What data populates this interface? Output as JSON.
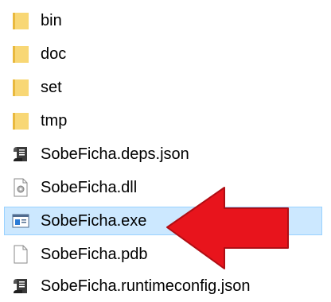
{
  "files": [
    {
      "name": "bin",
      "icon": "folder-icon"
    },
    {
      "name": "doc",
      "icon": "folder-icon"
    },
    {
      "name": "set",
      "icon": "folder-icon"
    },
    {
      "name": "tmp",
      "icon": "folder-icon"
    },
    {
      "name": "SobeFicha.deps.json",
      "icon": "json-file-icon"
    },
    {
      "name": "SobeFicha.dll",
      "icon": "dll-file-icon"
    },
    {
      "name": "SobeFicha.exe",
      "icon": "exe-file-icon",
      "selected": true
    },
    {
      "name": "SobeFicha.pdb",
      "icon": "blank-file-icon"
    },
    {
      "name": "SobeFicha.runtimeconfig.json",
      "icon": "json-file-icon"
    }
  ],
  "colors": {
    "folder": "#f8d775",
    "selection_bg": "#cce8ff",
    "selection_border": "#99d1ff",
    "arrow": "#e8141c"
  },
  "annotation": {
    "icon": "red-arrow-icon",
    "points_to": "SobeFicha.exe"
  }
}
